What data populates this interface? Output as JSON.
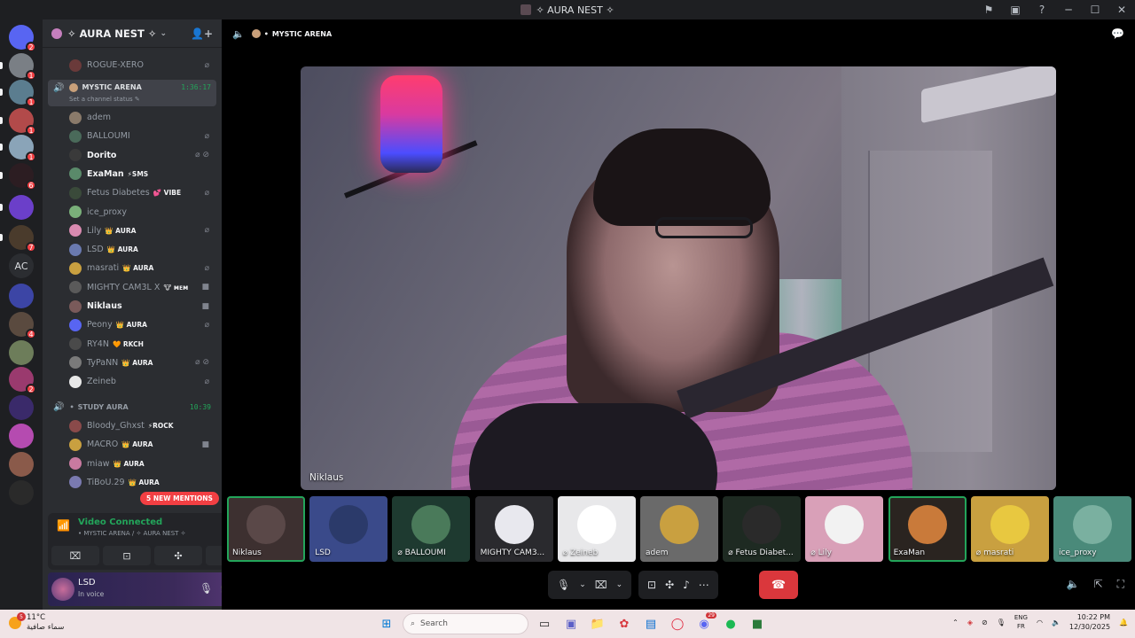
{
  "window": {
    "title": "✧ AURA NEST ✧"
  },
  "server_rail": {
    "items": [
      {
        "name": "discord-home",
        "badge": "2",
        "color": "#5865f2"
      },
      {
        "name": "server-1",
        "badge": "1",
        "color": "#7a7f85"
      },
      {
        "name": "server-2",
        "badge": "1",
        "color": "#5b7d8f"
      },
      {
        "name": "server-3",
        "badge": "1",
        "color": "#b24a4a"
      },
      {
        "name": "server-4",
        "badge": "1",
        "color": "#8aa4b8"
      },
      {
        "name": "server-5",
        "badge": "6",
        "color": "#2c1d22"
      },
      {
        "name": "server-6",
        "badge": "",
        "color": "#6b3fc9"
      },
      {
        "name": "server-7",
        "badge": "7",
        "color": "#4a3b2c"
      },
      {
        "name": "server-ac",
        "badge": "",
        "label": "AC"
      },
      {
        "name": "server-folder",
        "badge": "",
        "color": "#3c45a5"
      },
      {
        "name": "server-8",
        "badge": "4",
        "color": "#5a4a3f"
      },
      {
        "name": "server-9",
        "badge": "",
        "color": "#6d7d5a"
      },
      {
        "name": "server-10",
        "badge": "2",
        "color": "#9a3a6e"
      },
      {
        "name": "server-11",
        "badge": "",
        "color": "#3a2a6a"
      },
      {
        "name": "server-12",
        "badge": "",
        "color": "#b54bb0"
      },
      {
        "name": "server-13",
        "badge": "",
        "color": "#8a5a4a"
      },
      {
        "name": "server-14",
        "badge": "",
        "color": "#2a2a2a"
      }
    ]
  },
  "guild": {
    "name": "✧ AURA NEST ✧"
  },
  "channel_list": {
    "top_user": {
      "name": "ROGUE-XERO",
      "status": "⌀"
    },
    "mystic_arena": {
      "name": "MYSTIC ARENA",
      "timer": "1:36:17",
      "status_prompt": "Set a channel status ✎",
      "members": [
        {
          "name": "adem",
          "tag": "",
          "status": "",
          "bright": false,
          "color": "#8a7a6a"
        },
        {
          "name": "BALLOUMI",
          "tag": "",
          "status": "⌀",
          "bright": false,
          "color": "#4a6a5a"
        },
        {
          "name": "Dorito",
          "tag": "",
          "status": "⌀ ⊘",
          "bright": true,
          "color": "#3a3a3a"
        },
        {
          "name": "ExaMan",
          "tag": "⚡SMS",
          "status": "",
          "bright": true,
          "color": "#5a8a6a"
        },
        {
          "name": "Fetus Diabetes",
          "tag": "💕 VIBE",
          "status": "⌀",
          "bright": false,
          "color": "#3a4a3a"
        },
        {
          "name": "ice_proxy",
          "tag": "",
          "status": "",
          "bright": false,
          "color": "#7ab07a"
        },
        {
          "name": "Lily",
          "tag": "👑 AURA",
          "status": "⌀",
          "bright": false,
          "color": "#d98ab0"
        },
        {
          "name": "LSD",
          "tag": "👑 AURA",
          "status": "",
          "bright": false,
          "color": "#6a7ab0"
        },
        {
          "name": "masrati",
          "tag": "👑 AURA",
          "status": "⌀",
          "bright": false,
          "color": "#c9a040"
        },
        {
          "name": "MIGHTY CAM3L X",
          "tag": "🐮 ᴍᴇᴍ",
          "status": "■",
          "bright": false,
          "color": "#5a5a5a"
        },
        {
          "name": "Niklaus",
          "tag": "",
          "status": "■",
          "bright": true,
          "color": "#7a5a5a"
        },
        {
          "name": "Peony",
          "tag": "👑 AURA",
          "status": "⌀",
          "bright": false,
          "color": "#5865f2"
        },
        {
          "name": "RY4N",
          "tag": "🧡 RKCH",
          "status": "",
          "bright": false,
          "color": "#4a4a4a"
        },
        {
          "name": "TyPaNN",
          "tag": "👑 AURA",
          "status": "⌀ ⊘",
          "bright": false,
          "color": "#7a7a7a"
        },
        {
          "name": "Zeineb",
          "tag": "",
          "status": "⌀",
          "bright": false,
          "color": "#e8e8e8"
        }
      ]
    },
    "study_aura": {
      "name": "STUDY AURA",
      "timer": "10:39",
      "members": [
        {
          "name": "Bloody_Ghxst",
          "tag": "⚡ROCK",
          "status": "",
          "bright": false,
          "color": "#8a4a4a"
        },
        {
          "name": "MACRO",
          "tag": "👑 AURA",
          "status": "■",
          "bright": false,
          "color": "#c9a040"
        },
        {
          "name": "miaw",
          "tag": "👑 AURA",
          "status": "",
          "bright": false,
          "color": "#c97aa0"
        },
        {
          "name": "TiBoU.29",
          "tag": "👑 AURA",
          "status": "",
          "bright": false,
          "color": "#7a7ab0"
        }
      ]
    },
    "mentions_label": "5 NEW MENTIONS"
  },
  "voice_panel": {
    "status": "Video Connected",
    "location": "• MYSTIC ARENA / ✧ AURA NEST ✧",
    "buttons": [
      "camera-off",
      "screen-share",
      "activities",
      "soundboard"
    ]
  },
  "user_panel": {
    "name": "LSD",
    "status": "In voice"
  },
  "main": {
    "channel_name": "MYSTIC ARENA",
    "spotlight_name": "Niklaus",
    "participants": [
      {
        "name": "Niklaus",
        "color": "#3d3030",
        "speaking": true,
        "avatar": "#5a4848"
      },
      {
        "name": "LSD",
        "color": "#3a4a8a",
        "speaking": false,
        "avatar": "#2b3a6a"
      },
      {
        "name": "BALLOUMI",
        "color": "#1e3a30",
        "speaking": false,
        "avatar": "#4a7a5a",
        "muted": true
      },
      {
        "name": "MIGHTY CAM3...",
        "color": "#2a2a2e",
        "speaking": false,
        "avatar": "#e8e8ee"
      },
      {
        "name": "Zeineb",
        "color": "#e8e8ea",
        "speaking": false,
        "avatar": "#ffffff",
        "muted": true
      },
      {
        "name": "adem",
        "color": "#6a6a6a",
        "speaking": false,
        "avatar": "#c9a040"
      },
      {
        "name": "Fetus Diabet...",
        "color": "#1e2a22",
        "speaking": false,
        "avatar": "#2a2a2a",
        "muted": true
      },
      {
        "name": "Lily",
        "color": "#d9a0b8",
        "speaking": false,
        "avatar": "#f2f2f2",
        "muted": true
      },
      {
        "name": "ExaMan",
        "color": "#2a2420",
        "speaking": true,
        "avatar": "#c97a3a"
      },
      {
        "name": "masrati",
        "color": "#c9a040",
        "speaking": false,
        "avatar": "#e8c840",
        "muted": true
      },
      {
        "name": "ice_proxy",
        "color": "#4a8a7a",
        "speaking": false,
        "avatar": "#7ab0a0"
      }
    ]
  },
  "taskbar": {
    "weather_temp": "11°C",
    "weather_desc": "سماء صافية",
    "weather_badge": "5",
    "search_placeholder": "Search",
    "lang_line1": "ENG",
    "lang_line2": "FR",
    "time": "10:22 PM",
    "date": "12/30/2025",
    "discord_badge": "29"
  }
}
